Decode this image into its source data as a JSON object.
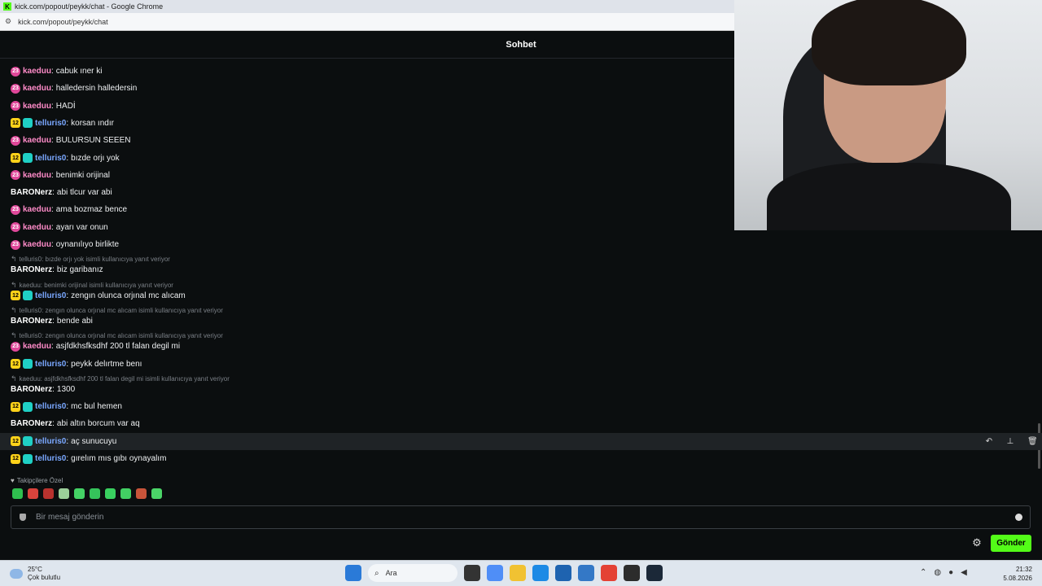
{
  "window": {
    "title": "kick.com/popout/peykk/chat - Google Chrome",
    "url": "kick.com/popout/peykk/chat"
  },
  "chat": {
    "header_title": "Sohbet",
    "messages": [
      {
        "user": "kaeduu",
        "text": "cabuk ıner ki",
        "badge": "23"
      },
      {
        "user": "kaeduu",
        "text": "halledersin halledersin",
        "badge": "23"
      },
      {
        "user": "kaeduu",
        "text": "HADİ",
        "badge": "23"
      },
      {
        "user": "telluris0",
        "text": "korsan ındır",
        "badge": "12"
      },
      {
        "user": "kaeduu",
        "text": "BULURSUN SEEEN",
        "badge": "23"
      },
      {
        "user": "telluris0",
        "text": "bızde orjı yok",
        "badge": "12"
      },
      {
        "user": "kaeduu",
        "text": "benimki orijinal",
        "badge": "23"
      },
      {
        "user": "BARONerz",
        "text": "abi tlcur var abi"
      },
      {
        "user": "kaeduu",
        "text": "ama bozmaz bence",
        "badge": "23"
      },
      {
        "user": "kaeduu",
        "text": "ayarı var onun",
        "badge": "23"
      },
      {
        "user": "kaeduu",
        "text": "oynanılıyo birlikte",
        "badge": "23"
      },
      {
        "reply": "telluris0: bızde orjı yok isimli kullanıcıya yanıt veriyor",
        "user": "BARONerz",
        "text": "biz garibanız"
      },
      {
        "reply": "kaeduu: benimki orijinal isimli kullanıcıya yanıt veriyor",
        "user": "telluris0",
        "text": "zengın olunca orjınal mc alıcam",
        "badge": "12"
      },
      {
        "reply": "telluris0: zengın olunca orjınal mc alıcam isimli kullanıcıya yanıt veriyor",
        "user": "BARONerz",
        "text": "bende abi"
      },
      {
        "reply": "telluris0: zengın olunca orjınal mc alıcam isimli kullanıcıya yanıt veriyor",
        "user": "kaeduu",
        "text": "asjfdkhsfksdhf 200 tl falan degil mi",
        "badge": "23"
      },
      {
        "user": "telluris0",
        "text": "peykk delırtme benı",
        "badge": "12"
      },
      {
        "reply": "kaeduu: asjfdkhsfksdhf 200 tl falan degil mi isimli kullanıcıya yanıt veriyor",
        "user": "BARONerz",
        "text": "1300"
      },
      {
        "user": "telluris0",
        "text": "mc bul hemen",
        "badge": "12"
      },
      {
        "user": "BARONerz",
        "text": "abi altın borcum var aq"
      },
      {
        "user": "telluris0",
        "text": "aç sunucuyu",
        "badge": "12"
      },
      {
        "user": "telluris0",
        "text": "gırelım mıs gıbı oynayalım",
        "badge": "12"
      }
    ],
    "followers_only": "Takipçilere Özel",
    "input_placeholder": "Bir mesaj gönderin",
    "send_label": "Gönder"
  },
  "taskbar": {
    "weather_temp": "25°C",
    "weather_desc": "Çok bulutlu",
    "search_label": "Ara",
    "time": "21:32",
    "date": "5.08.2026"
  },
  "colors": {
    "accent": "#53fc18",
    "kaeduu": "#ff8bc8",
    "telluris": "#7aa8ff"
  }
}
